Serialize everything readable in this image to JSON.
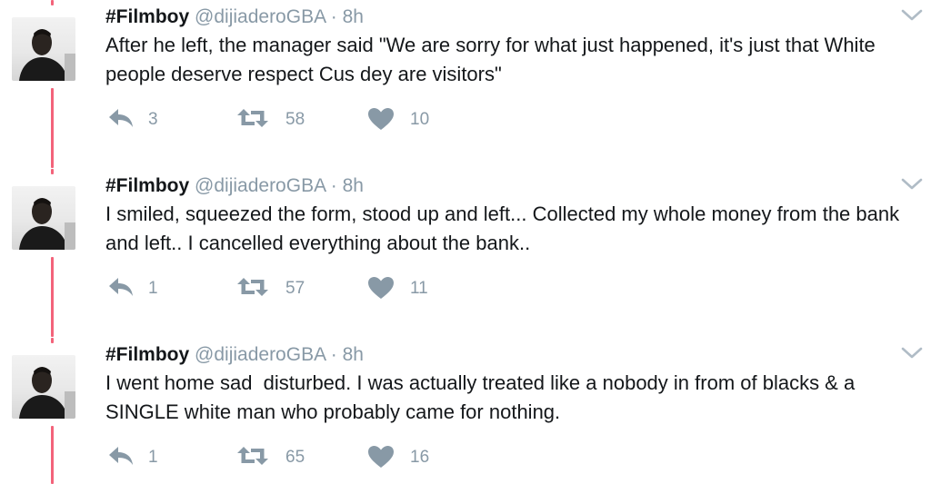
{
  "tweets": [
    {
      "name": "#Filmboy",
      "handle": "@dijiaderoGBA",
      "separator": "·",
      "time": "8h",
      "text": "After he left, the manager said \"We are sorry for what just happened, it's just that White people deserve respect Cus dey are visitors\"",
      "replies": "3",
      "retweets": "58",
      "likes": "10"
    },
    {
      "name": "#Filmboy",
      "handle": "@dijiaderoGBA",
      "separator": "·",
      "time": "8h",
      "text": "I smiled, squeezed the form, stood up and left... Collected my whole money from the bank and left.. I cancelled everything about the bank..",
      "replies": "1",
      "retweets": "57",
      "likes": "11"
    },
    {
      "name": "#Filmboy",
      "handle": "@dijiaderoGBA",
      "separator": "·",
      "time": "8h",
      "text": "I went home sad  disturbed. I was actually treated like a nobody in from of blacks & a SINGLE white man who probably came for nothing.",
      "replies": "1",
      "retweets": "65",
      "likes": "16"
    }
  ],
  "colors": {
    "thread_line": "#f3637a",
    "icon_gray": "#8899a6",
    "text": "#14171a"
  },
  "icons": {
    "reply": "reply-icon",
    "retweet": "retweet-icon",
    "like": "heart-icon",
    "more": "chevron-down-icon"
  }
}
